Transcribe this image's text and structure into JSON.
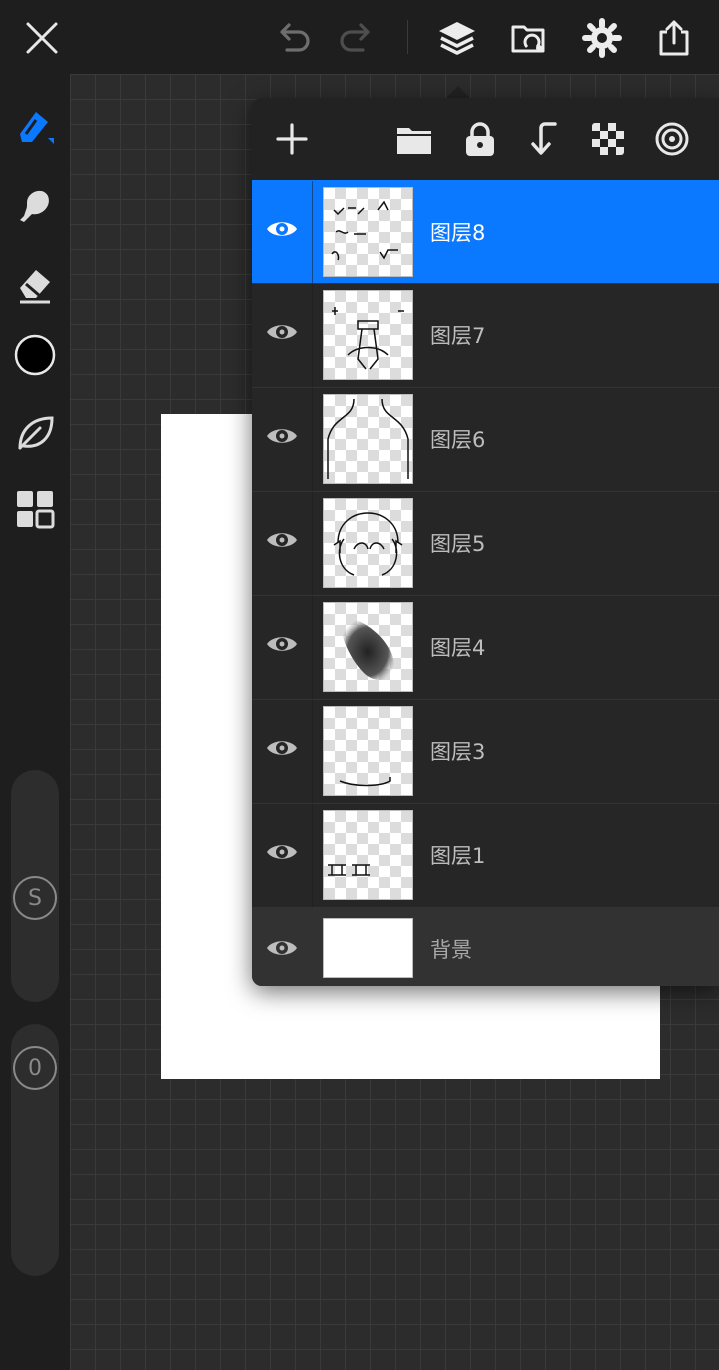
{
  "app": {
    "accent": "#0a78ff",
    "background": "#2b2b2b"
  },
  "toolbar": {
    "icons": [
      "close-icon",
      "undo-icon",
      "redo-icon",
      "layers-icon",
      "gallery-icon",
      "settings-icon",
      "share-icon"
    ]
  },
  "sidebar": {
    "tools": [
      "brush-icon",
      "smudge-icon",
      "eraser-icon",
      "color-swatch",
      "leaf-icon",
      "grid-icon"
    ],
    "current_color": "#000000",
    "size_slider_label": "S",
    "opacity_slider_label": "0"
  },
  "layers_panel": {
    "toolbar_icons": [
      "add-icon",
      "folder-icon",
      "lock-icon",
      "merge-down-icon",
      "checkerboard-icon",
      "target-icon"
    ],
    "layers": [
      {
        "name": "图层8",
        "selected": true
      },
      {
        "name": "图层7",
        "selected": false
      },
      {
        "name": "图层6",
        "selected": false
      },
      {
        "name": "图层5",
        "selected": false
      },
      {
        "name": "图层4",
        "selected": false
      },
      {
        "name": "图层3",
        "selected": false
      },
      {
        "name": "图层1",
        "selected": false
      }
    ],
    "background": {
      "name": "背景"
    }
  }
}
